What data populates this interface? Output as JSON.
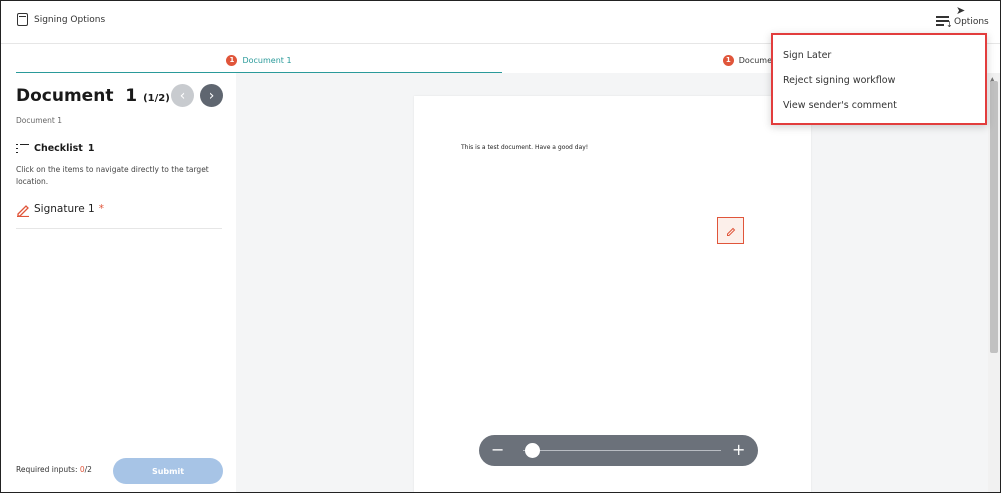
{
  "header": {
    "brand_label": "Signing Options",
    "options_label": "Options"
  },
  "tabs": [
    {
      "badge": "1",
      "label": "Document 1"
    },
    {
      "badge": "1",
      "label": "Document"
    }
  ],
  "left": {
    "doc_title": "Document",
    "doc_number": "1",
    "doc_count": "(1/2)",
    "doc_subtitle": "Document 1",
    "checklist_label": "Checklist",
    "checklist_count": "1",
    "help_text": "Click on the items to navigate directly to the target location.",
    "items": [
      {
        "label": "Signature 1",
        "required_mark": "*"
      }
    ],
    "required_label": "Required inputs: ",
    "required_done": "0",
    "required_total": "/2",
    "submit_label": "Submit"
  },
  "document": {
    "text": "This is a test document. Have a good day!"
  },
  "zoom": {
    "minus": "−",
    "plus": "+",
    "level": 0.05
  },
  "menu": {
    "items": [
      "Sign Later",
      "Reject signing workflow",
      "View sender's comment"
    ]
  },
  "colors": {
    "accent": "#2a9a9a",
    "alert": "#e0553a",
    "submit_disabled": "#a7c4e6",
    "menu_highlight_border": "#e23d3d"
  }
}
